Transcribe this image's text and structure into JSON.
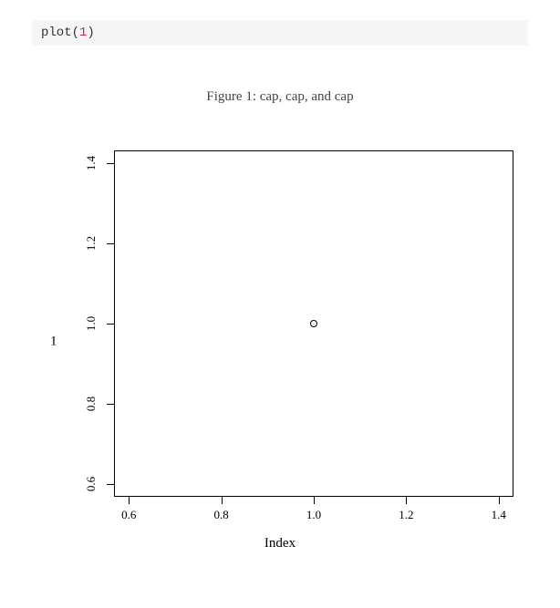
{
  "code": {
    "fn": "plot",
    "open": "(",
    "arg": "1",
    "close": ")"
  },
  "caption": "Figure 1: cap, cap, and cap",
  "chart_data": {
    "type": "scatter",
    "x": [
      1.0
    ],
    "y": [
      1.0
    ],
    "xlabel": "Index",
    "ylabel": "1",
    "xlim": [
      0.6,
      1.4
    ],
    "ylim": [
      0.6,
      1.4
    ],
    "x_ticks": [
      0.6,
      0.8,
      1.0,
      1.2,
      1.4
    ],
    "y_ticks": [
      0.6,
      0.8,
      1.0,
      1.2,
      1.4
    ],
    "x_tick_labels": [
      "0.6",
      "0.8",
      "1.0",
      "1.2",
      "1.4"
    ],
    "y_tick_labels": [
      "0.6",
      "0.8",
      "1.0",
      "1.2",
      "1.4"
    ]
  }
}
